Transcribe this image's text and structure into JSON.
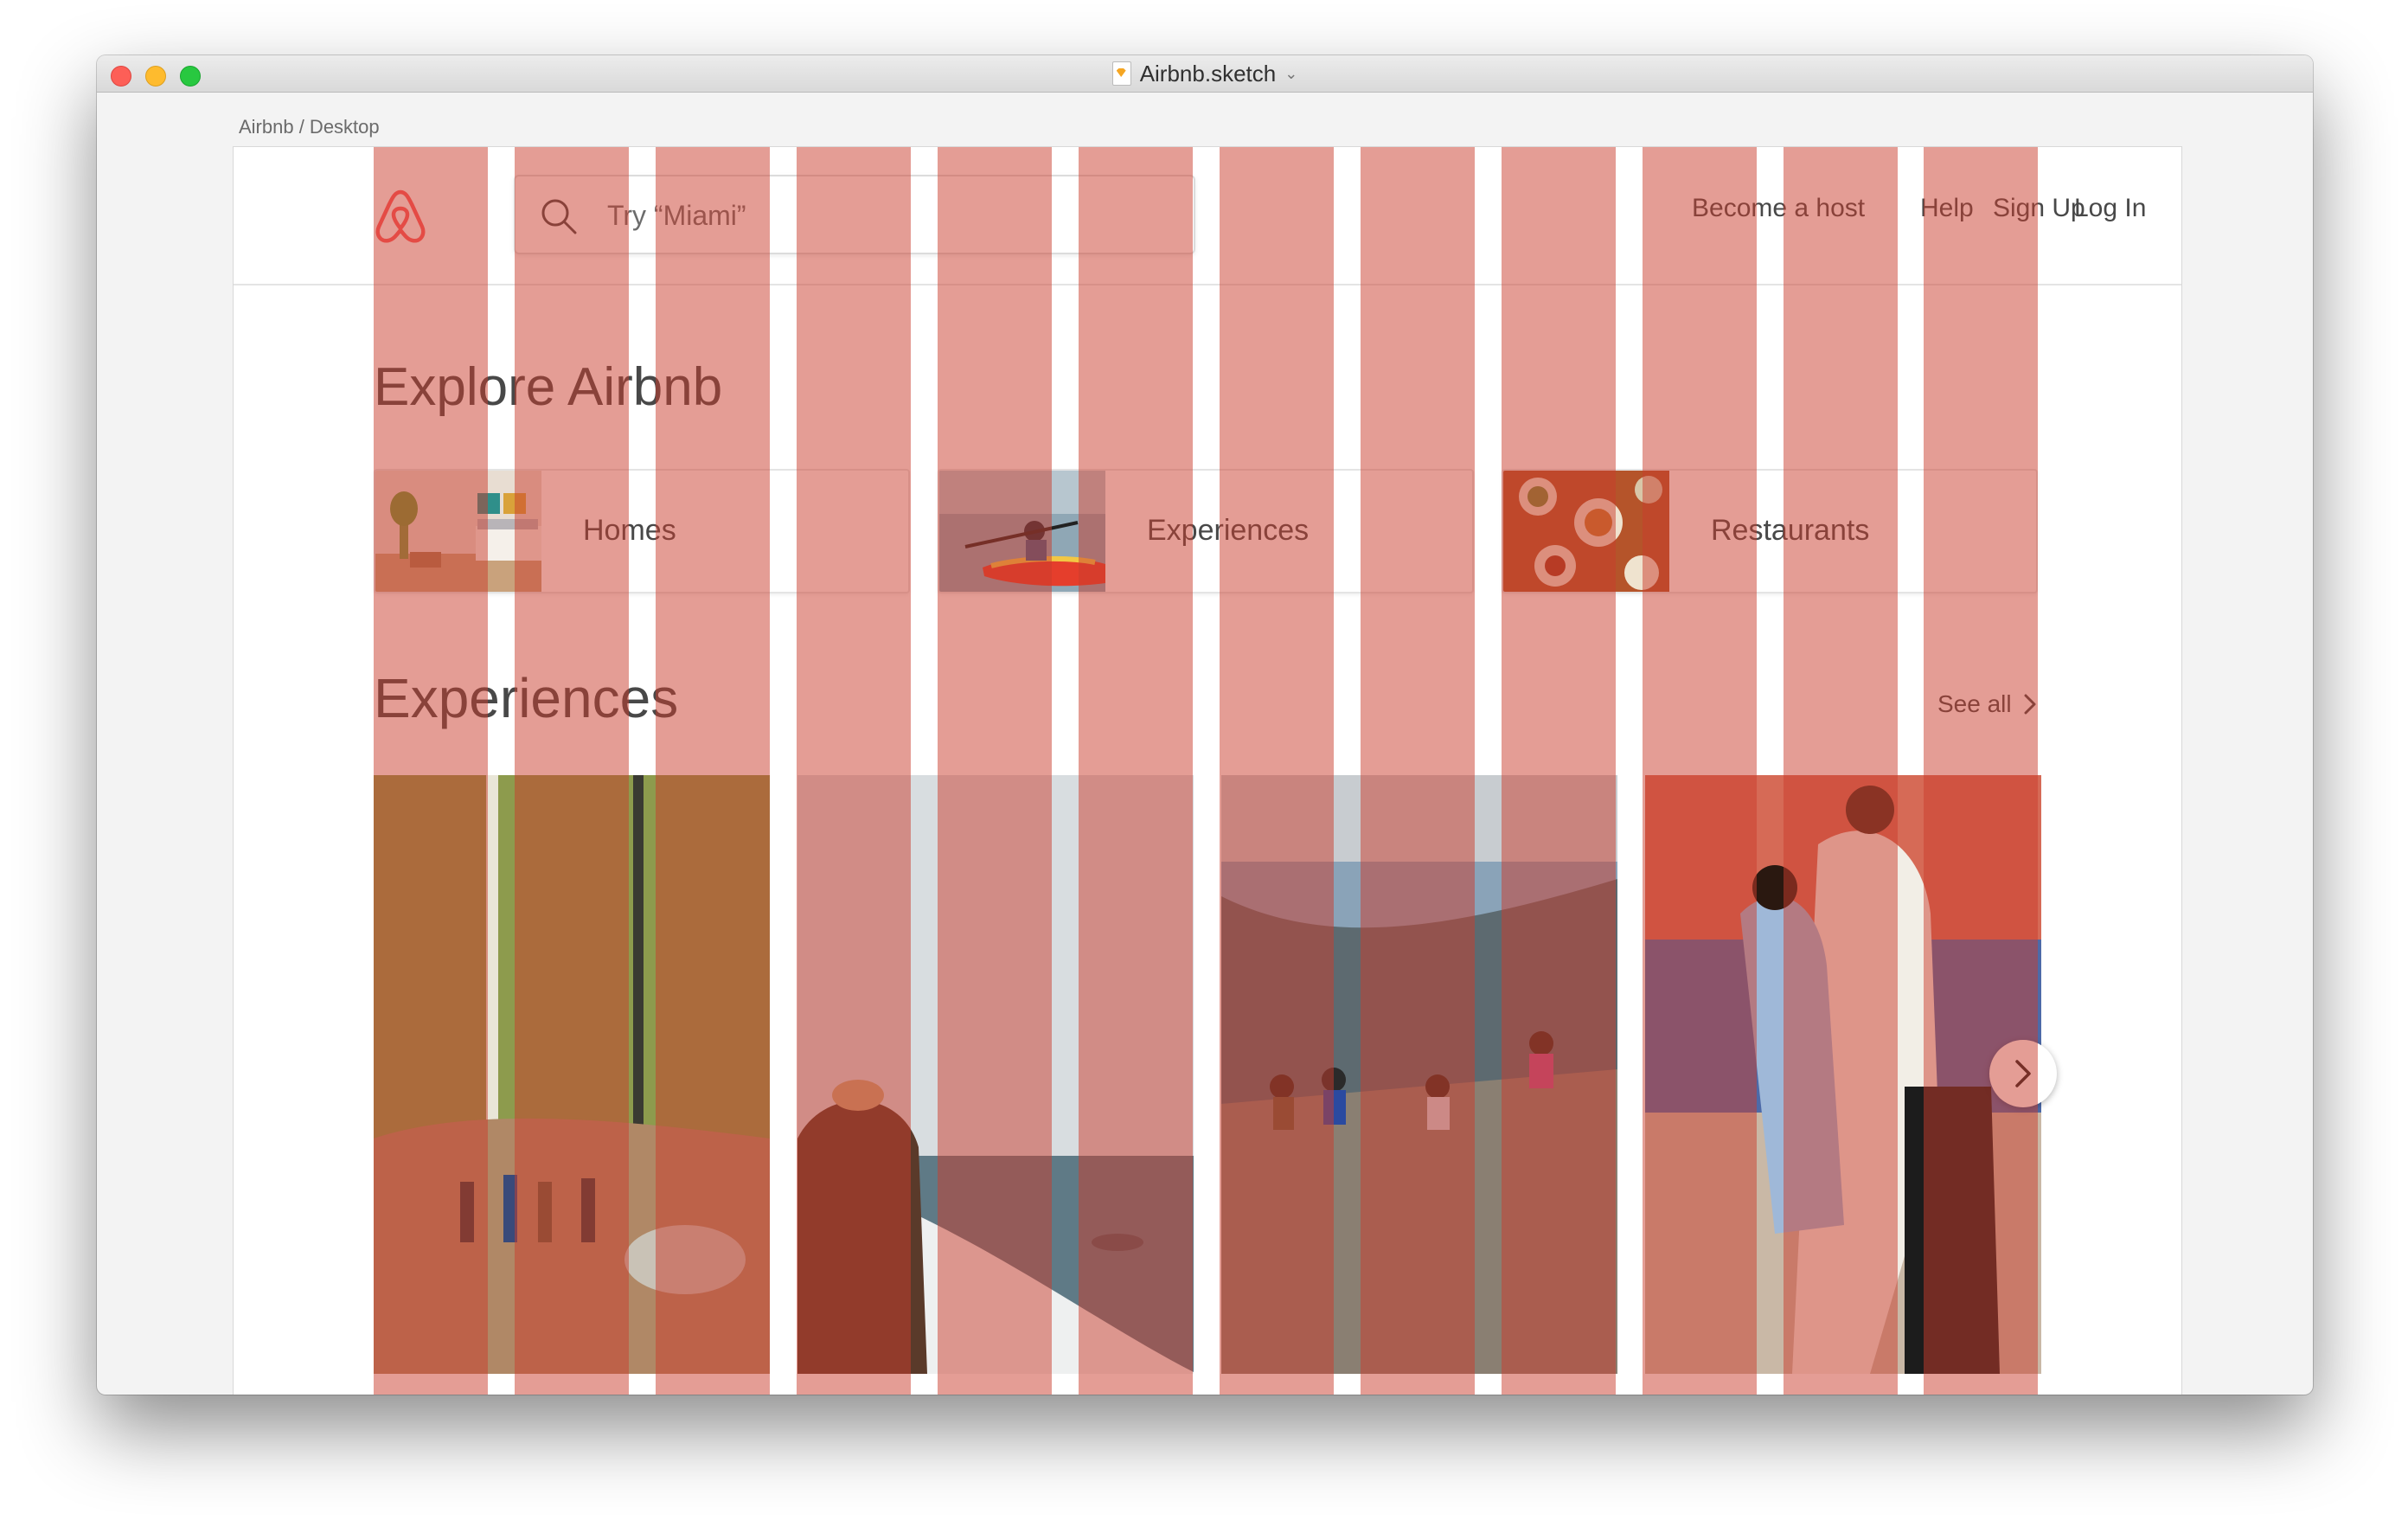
{
  "window": {
    "title": "Airbnb.sketch"
  },
  "artboard": {
    "label": "Airbnb / Desktop"
  },
  "header": {
    "search_placeholder": "Try “Miami”",
    "links": [
      "Become a host",
      "Help",
      "Sign Up",
      "Log In"
    ]
  },
  "explore": {
    "title": "Explore Airbnb",
    "categories": [
      {
        "label": "Homes",
        "image": "bedroom-photo"
      },
      {
        "label": "Experiences",
        "image": "kayak-photo"
      },
      {
        "label": "Restaurants",
        "image": "dinner-table-photo"
      }
    ]
  },
  "experiences": {
    "title": "Experiences",
    "see_all_label": "See all",
    "cards": [
      {
        "image": "forest-hike-photo"
      },
      {
        "image": "boat-dolphins-photo"
      },
      {
        "image": "mountain-view-photo"
      },
      {
        "image": "salsa-dancers-photo"
      }
    ]
  },
  "colors": {
    "brand": "#ff5a5f",
    "text": "#484848",
    "grid_overlay": "#c93c2c"
  }
}
